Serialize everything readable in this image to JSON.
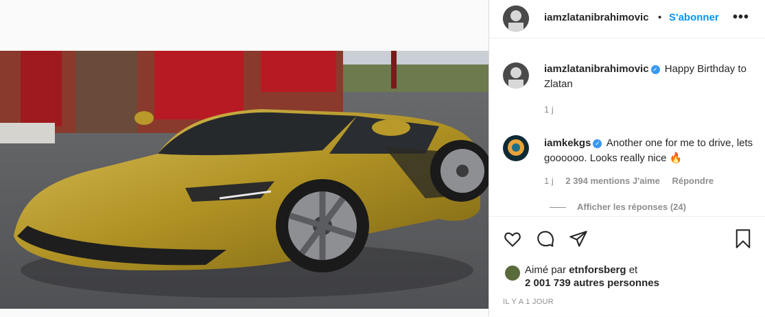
{
  "post": {
    "author": "iamzlatanibrahimovic",
    "separator": "•",
    "follow_label": "S'abonner",
    "more_icon": "ellipsis-icon",
    "more_label": "•••"
  },
  "comments": [
    {
      "user": "iamzlatanibrahimovic",
      "verified": true,
      "text": "Happy Birthday to Zlatan",
      "time": "1 j"
    },
    {
      "user": "iamkekgs",
      "verified": true,
      "text": "Another one for me to drive, lets goooooo. Looks really nice 🔥",
      "time": "1 j",
      "likes": "2 394 mentions J'aime",
      "reply_label": "Répondre",
      "view_replies": "Afficher les réponses (24)"
    }
  ],
  "actions": {
    "like_icon": "heart-icon",
    "comment_icon": "comment-icon",
    "share_icon": "send-icon",
    "save_icon": "bookmark-icon"
  },
  "likes": {
    "prefix": "Aimé par",
    "user": "etnforsberg",
    "suffix": "et",
    "others": "2 001 739 autres personnes"
  },
  "timestamp": "IL Y A 1 JOUR",
  "colors": {
    "accent": "#0095f6",
    "verified": "#3897f0",
    "muted": "#8e8e8e",
    "car_gold": "#b59a2a"
  }
}
